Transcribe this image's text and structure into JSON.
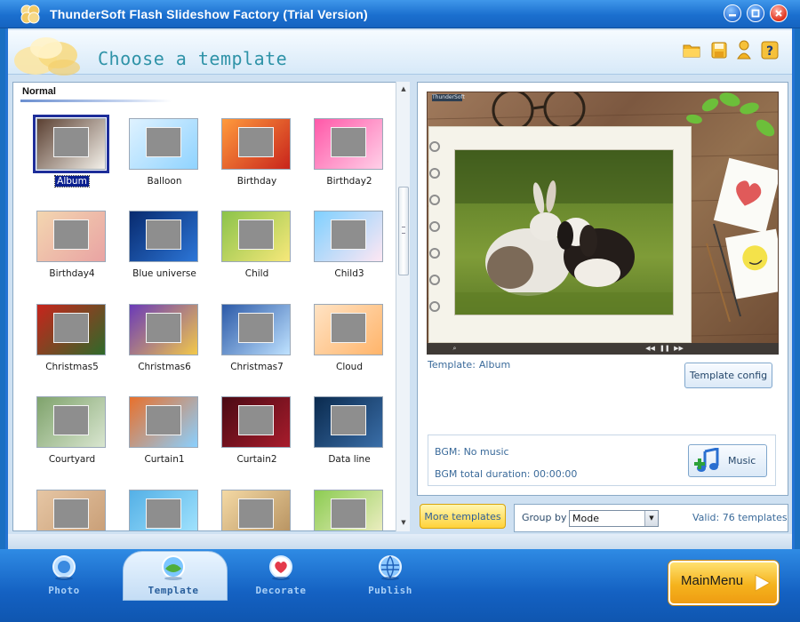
{
  "window": {
    "title": "ThunderSoft Flash Slideshow Factory (Trial Version)"
  },
  "header": {
    "page_title": "Choose a template"
  },
  "template_list": {
    "category": "Normal",
    "templates": [
      {
        "name": "Album",
        "selected": true
      },
      {
        "name": "Balloon"
      },
      {
        "name": "Birthday"
      },
      {
        "name": "Birthday2"
      },
      {
        "name": "Birthday4"
      },
      {
        "name": "Blue universe"
      },
      {
        "name": "Child"
      },
      {
        "name": "Child3"
      },
      {
        "name": "Christmas5"
      },
      {
        "name": "Christmas6"
      },
      {
        "name": "Christmas7"
      },
      {
        "name": "Cloud"
      },
      {
        "name": "Courtyard"
      },
      {
        "name": "Curtain1"
      },
      {
        "name": "Curtain2"
      },
      {
        "name": "Data line"
      },
      {
        "name": ""
      },
      {
        "name": ""
      },
      {
        "name": ""
      },
      {
        "name": ""
      }
    ]
  },
  "preview": {
    "brand": "ThunderSoft",
    "template_label": "Template:",
    "template_value": "Album",
    "config_button": "Template config"
  },
  "music": {
    "bgm_label": "BGM: No music",
    "bgm_duration": "BGM total duration: 00:00:00",
    "button": "Music"
  },
  "footer_bar": {
    "more_templates": "More templates",
    "group_by_label": "Group by",
    "group_by_value": "Mode",
    "valid_count": "Valid: 76 templates"
  },
  "bottom_nav": {
    "items": [
      {
        "label": "Photo"
      },
      {
        "label": "Template",
        "active": true
      },
      {
        "label": "Decorate"
      },
      {
        "label": "Publish"
      }
    ],
    "main_menu": "MainMenu"
  },
  "colors": {
    "accent_blue": "#1b6fcf",
    "title_teal": "#2f93a8",
    "selection_navy": "#0a1f8f",
    "main_menu_orange": "#f5b31d"
  }
}
